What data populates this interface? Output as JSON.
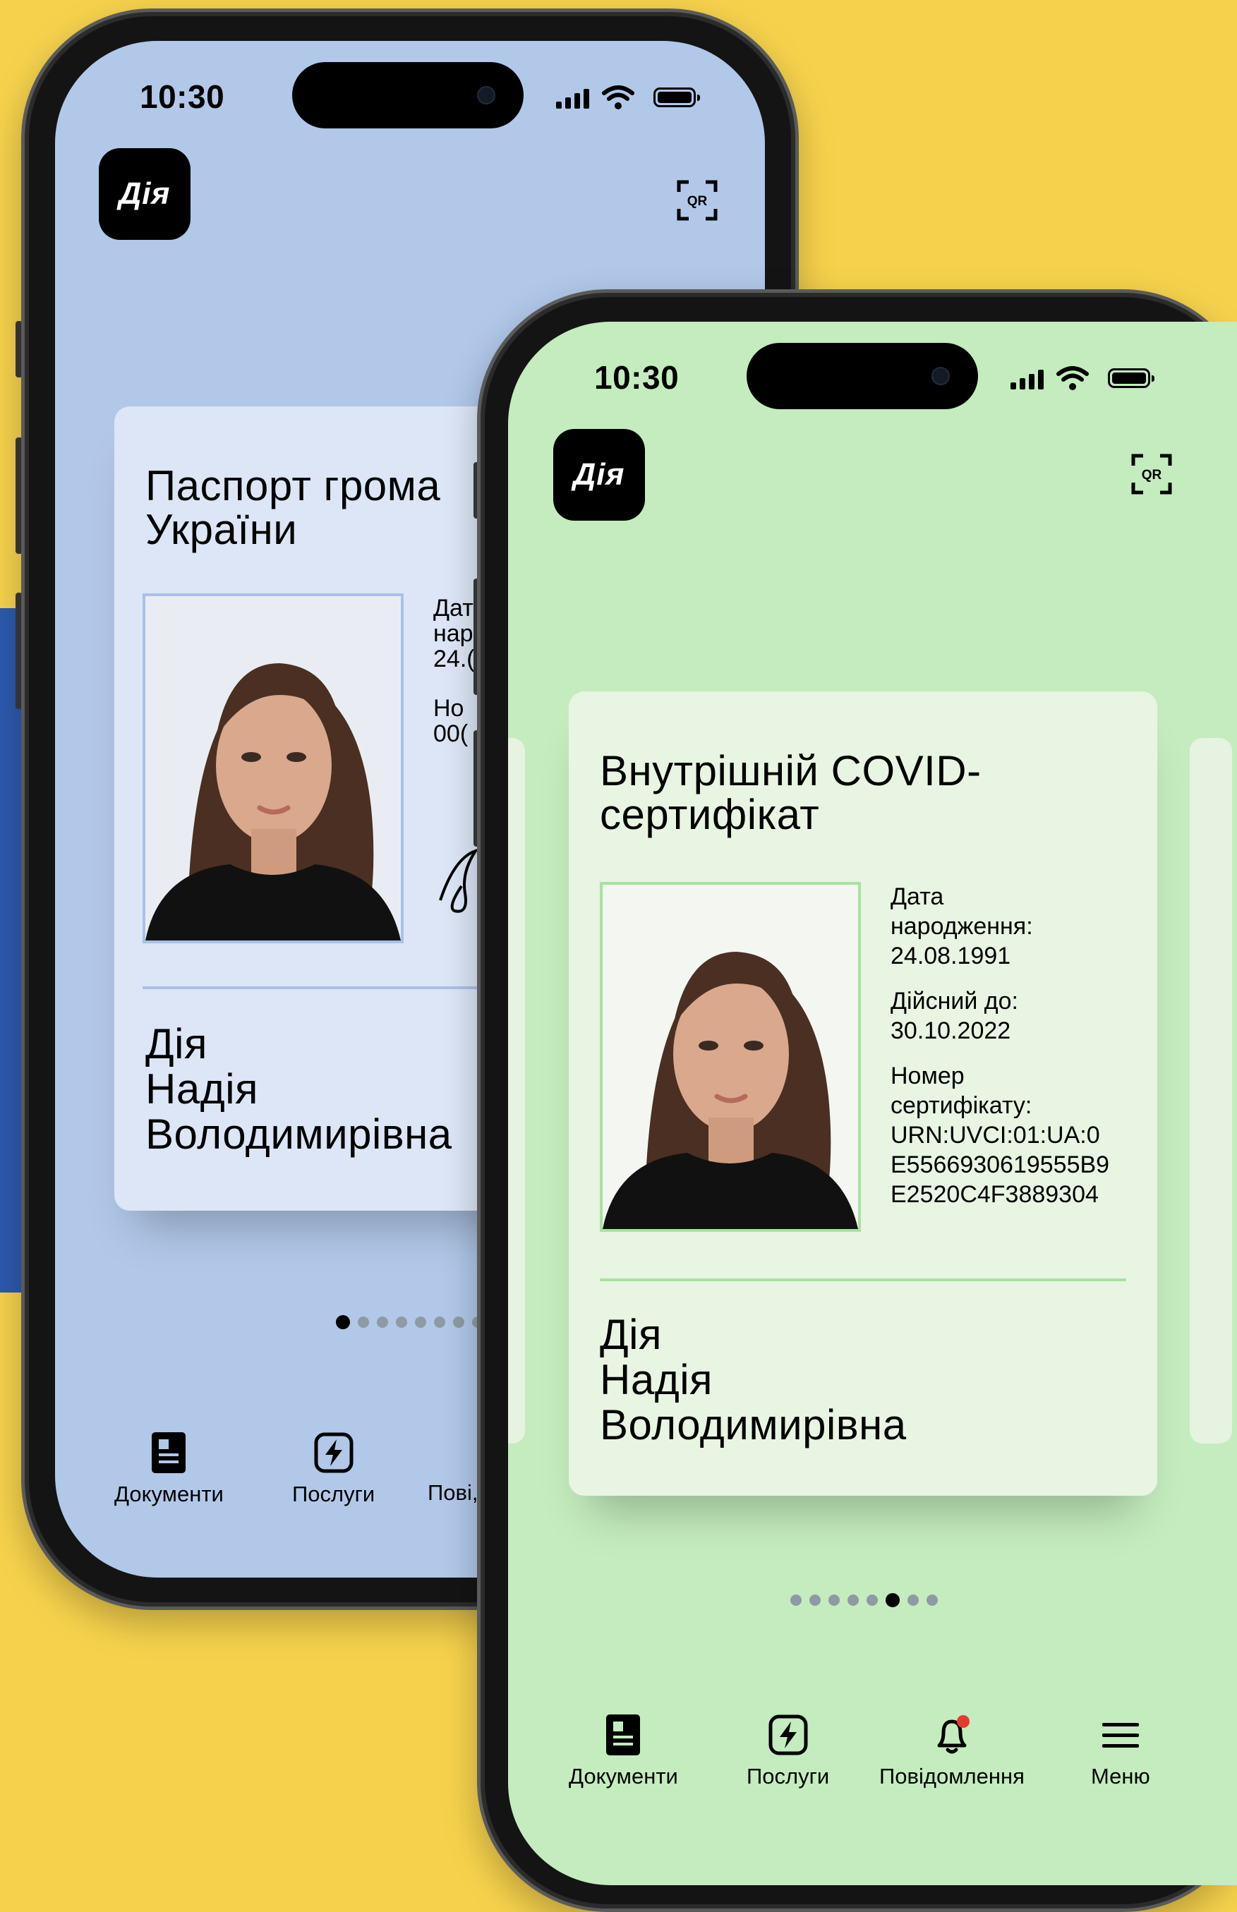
{
  "colors": {
    "background": "#f6d24c",
    "phone1_screen": "#b1c8e9",
    "phone2_screen": "#c4ecbe",
    "card1": "#dce6f6",
    "card2": "#e8f5e3"
  },
  "phone1": {
    "status": {
      "time": "10:30"
    },
    "logo": "Дія",
    "qr_label": "QR",
    "card": {
      "title_line1": "Паспорт грома",
      "title_line2": "України",
      "info": [
        "Дат",
        "нар",
        "24.(",
        "Но",
        "00("
      ],
      "name_line1": "Дія",
      "name_line2": "Надія",
      "name_line3": "Володимирівна"
    },
    "nav": {
      "documents": "Документи",
      "services": "Послуги",
      "notifications": "Пові,"
    }
  },
  "phone2": {
    "status": {
      "time": "10:30"
    },
    "logo": "Дія",
    "qr_label": "QR",
    "card": {
      "title_line1": "Внутрішній COVID-",
      "title_line2": "сертифікат",
      "birth_label_1": "Дата",
      "birth_label_2": "народження:",
      "birth_value": "24.08.1991",
      "valid_label": "Дійсний до:",
      "valid_value": "30.10.2022",
      "cert_label_1": "Номер",
      "cert_label_2": "сертифікату:",
      "cert_value_1": "URN:UVCI:01:UA:0",
      "cert_value_2": "E5566930619555B9",
      "cert_value_3": "E2520C4F3889304",
      "name_line1": "Дія",
      "name_line2": "Надія",
      "name_line3": "Володимирівна"
    },
    "nav": {
      "documents": "Документи",
      "services": "Послуги",
      "notifications": "Повідомлення",
      "menu": "Меню"
    }
  }
}
